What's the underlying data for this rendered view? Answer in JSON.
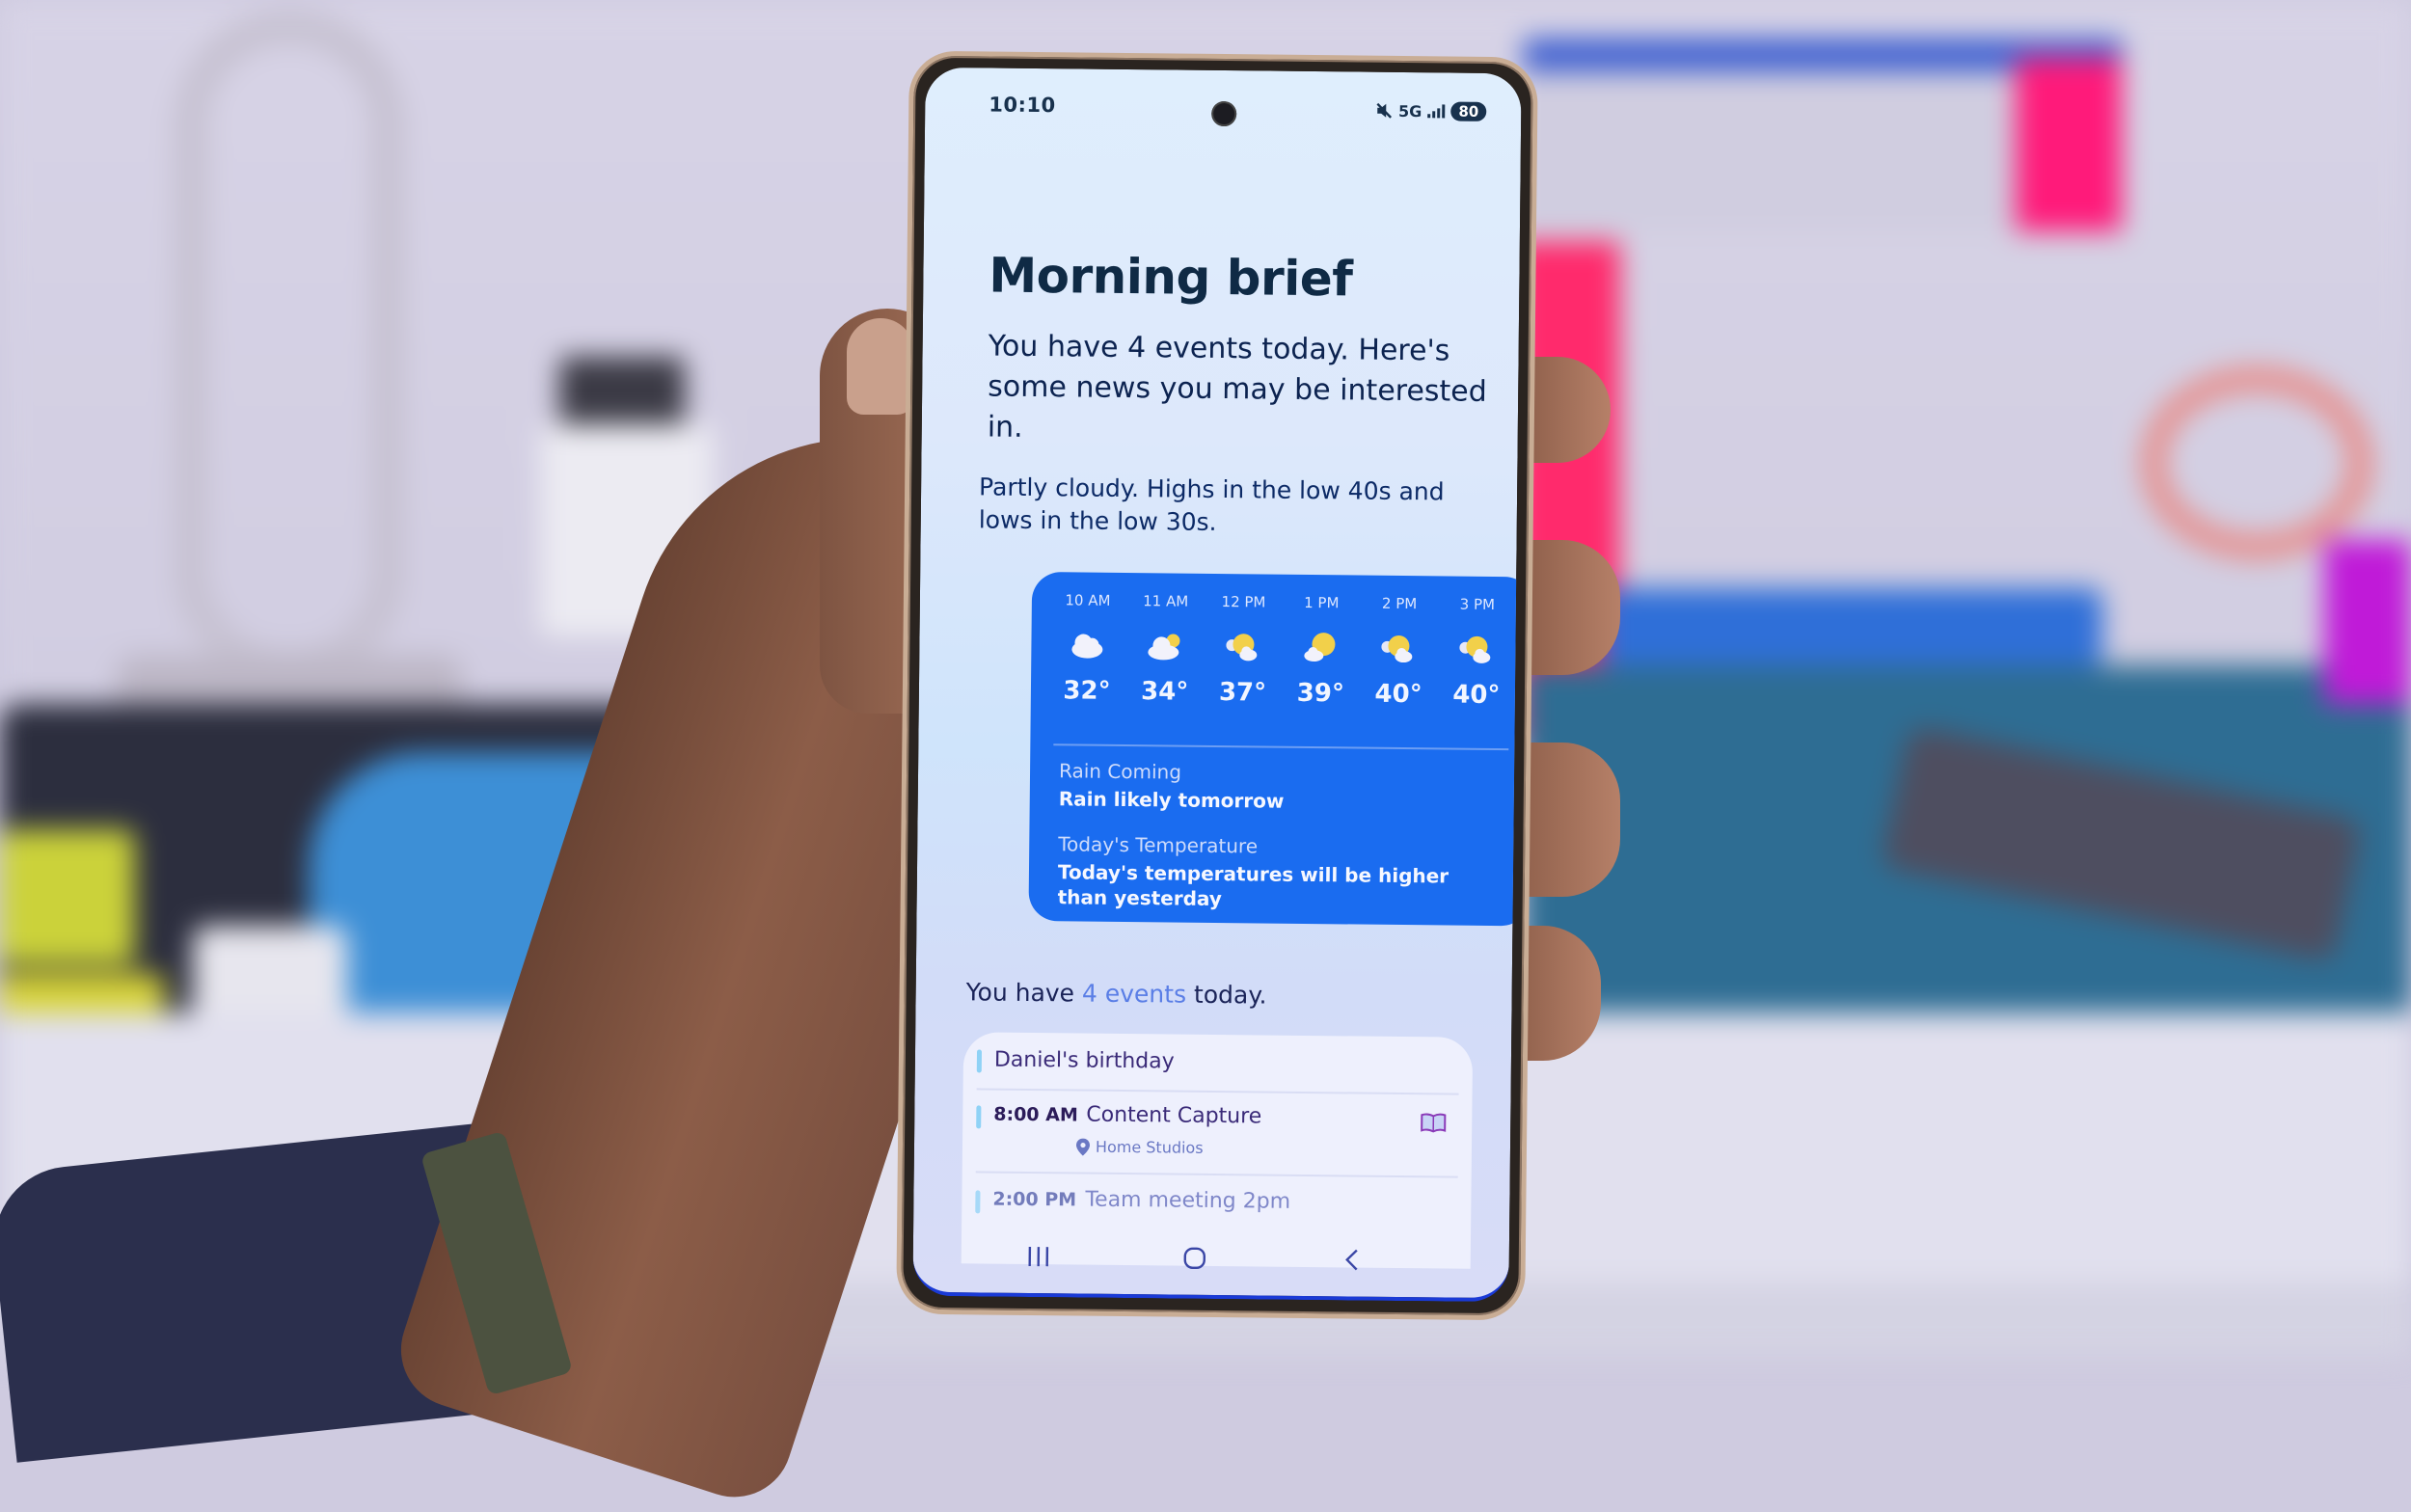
{
  "status_bar": {
    "time": "10:10",
    "network": "5G",
    "battery": "80",
    "icons": [
      "mute-icon",
      "signal-icon",
      "battery-icon"
    ]
  },
  "brief": {
    "title": "Morning brief",
    "intro": "You have 4 events today. Here's some news you may be interested in.",
    "forecast": "Partly cloudy. Highs in the low 40s and lows in the low 30s."
  },
  "weather": {
    "accent_color": "#1a6cf0",
    "hourly": [
      {
        "time": "10 AM",
        "icon": "cloudy-icon",
        "temp": "32°"
      },
      {
        "time": "11 AM",
        "icon": "mostly-cloudy-icon",
        "temp": "34°"
      },
      {
        "time": "12 PM",
        "icon": "partly-sunny-icon",
        "temp": "37°"
      },
      {
        "time": "1 PM",
        "icon": "mostly-sunny-icon",
        "temp": "39°"
      },
      {
        "time": "2 PM",
        "icon": "partly-sunny-icon",
        "temp": "40°"
      },
      {
        "time": "3 PM",
        "icon": "partly-sunny-icon",
        "temp": "40°"
      }
    ],
    "rain_label": "Rain Coming",
    "rain_value": "Rain likely tomorrow",
    "temp_label": "Today's Temperature",
    "temp_value": "Today's temperatures will be higher than yesterday"
  },
  "events": {
    "heading_pre": "You have ",
    "heading_count": "4 events",
    "heading_post": " today.",
    "items": [
      {
        "time": "",
        "name": "Daniel's birthday"
      },
      {
        "time": "8:00 AM",
        "name": "Content Capture",
        "location": "Home Studios",
        "icon": "book-icon"
      },
      {
        "time": "2:00 PM",
        "name": "Team meeting 2pm"
      }
    ]
  },
  "navigation": {
    "recents": "recents-icon",
    "home": "home-icon",
    "back": "back-icon"
  }
}
